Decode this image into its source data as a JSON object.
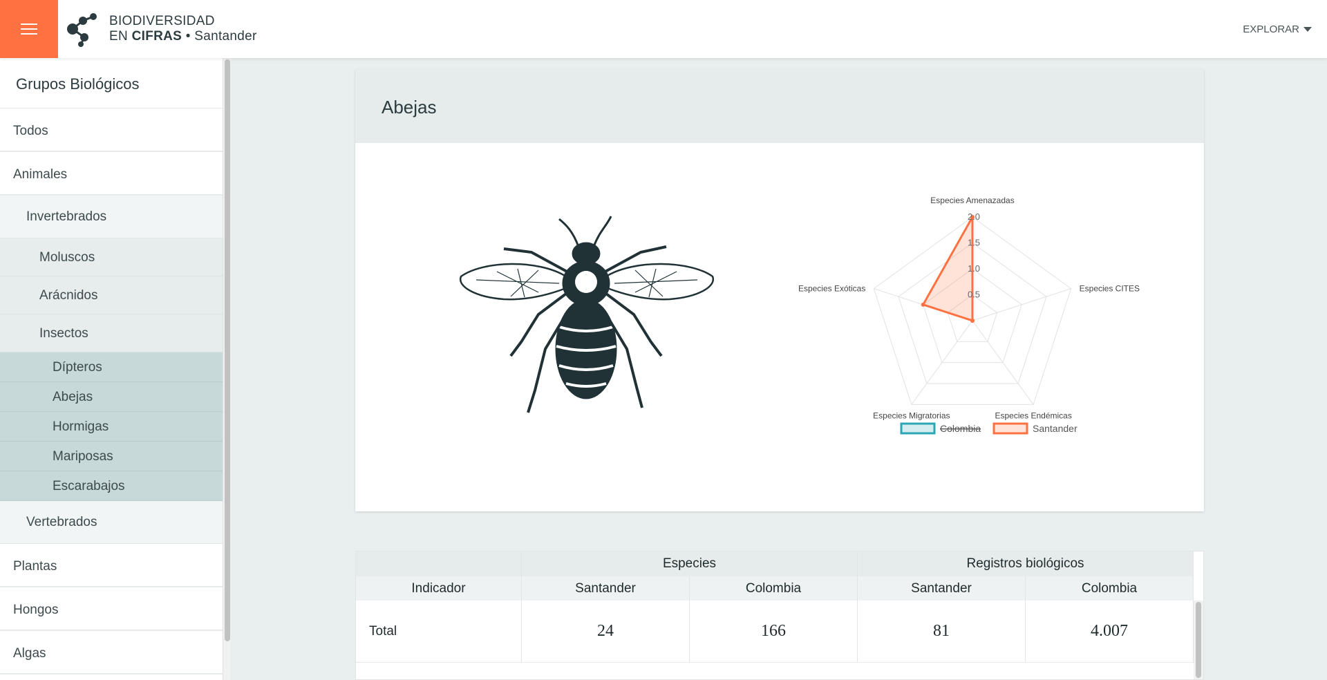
{
  "header": {
    "logo_line1": "BIODIVERSIDAD",
    "logo_line2_prefix": "EN",
    "logo_line2_bold": "CIFRAS",
    "logo_line2_suffix": "• Santander",
    "explore_label": "EXPLORAR"
  },
  "sidebar": {
    "title": "Grupos Biológicos",
    "items": {
      "todos": "Todos",
      "animales": "Animales",
      "invertebrados": "Invertebrados",
      "moluscos": "Moluscos",
      "aracnidos": "Arácnidos",
      "insectos": "Insectos",
      "dipteros": "Dípteros",
      "abejas": "Abejas",
      "hormigas": "Hormigas",
      "mariposas": "Mariposas",
      "escarabajos": "Escarabajos",
      "vertebrados": "Vertebrados",
      "plantas": "Plantas",
      "hongos": "Hongos",
      "algas": "Algas"
    }
  },
  "card": {
    "title": "Abejas",
    "image_icon": "bee-illustration"
  },
  "chart_data": {
    "type": "radar",
    "axes": [
      "Especies Amenazadas",
      "Especies CITES",
      "Especies Endémicas",
      "Especies Migratorias",
      "Especies Exóticas"
    ],
    "ticks": [
      "0.5",
      "1.0",
      "1.5",
      "2.0"
    ],
    "rmax": 2,
    "series": [
      {
        "name": "Colombia",
        "hidden": true,
        "color": "#2aa6b4",
        "values": []
      },
      {
        "name": "Santander",
        "hidden": false,
        "color": "#ff7140",
        "values": [
          2,
          0,
          0,
          0,
          1
        ]
      }
    ],
    "legend_position": "bottom"
  },
  "table": {
    "group_headers": [
      "Especies",
      "Registros biológicos"
    ],
    "col_headers": [
      "Indicador",
      "Santander",
      "Colombia",
      "Santander",
      "Colombia"
    ],
    "rows": [
      {
        "label": "Total",
        "values": [
          "24",
          "166",
          "81",
          "4.007"
        ]
      }
    ]
  },
  "colors": {
    "accent": "#ff7140",
    "sidebar_active": "#c7dad9",
    "colombia": "#2aa6b4"
  }
}
